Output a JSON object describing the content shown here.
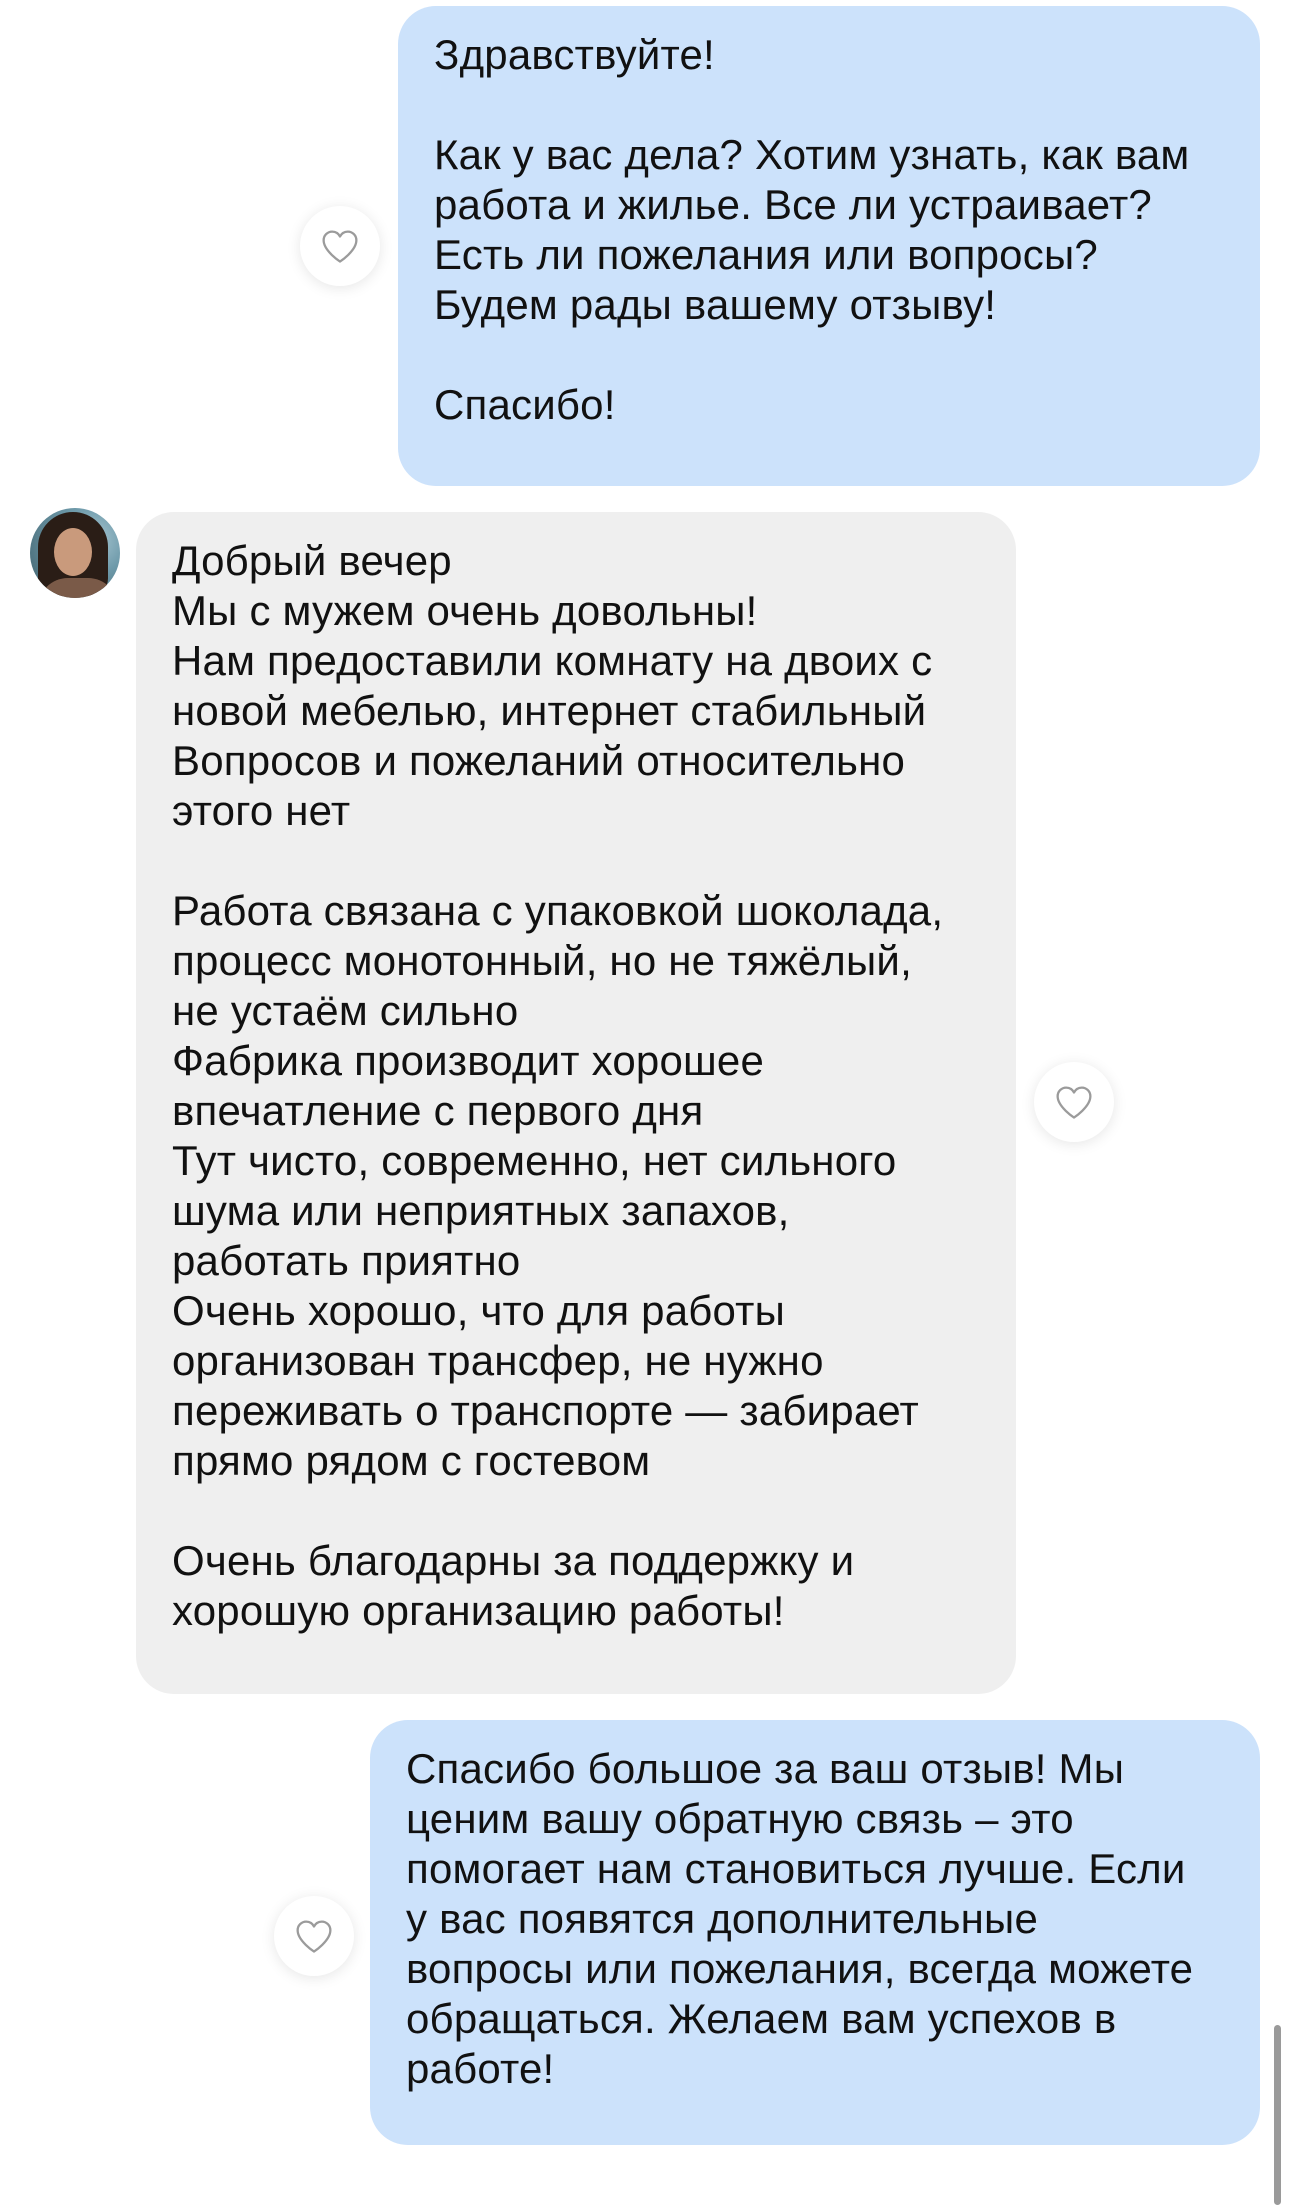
{
  "messages": [
    {
      "direction": "outgoing",
      "lines": [
        "Здравствуйте!",
        "",
        "Как у вас дела? Хотим узнать, как вам",
        "работа и жилье. Все ли устраивает?",
        "Есть ли пожелания или вопросы?",
        "Будем рады вашему отзыву!",
        "",
        "Спасибо!"
      ]
    },
    {
      "direction": "incoming",
      "lines": [
        "Добрый вечер",
        "Мы с мужем очень довольны!",
        "Нам предоставили комнату на двоих с",
        "новой мебелью, интернет стабильный",
        "Вопросов и пожеланий относительно",
        "этого нет",
        "",
        "Работа связана с упаковкой шоколада,",
        "процесс монотонный, но не тяжёлый,",
        "не устаём сильно",
        "Фабрика производит хорошее",
        "впечатление с первого дня",
        "Тут чисто, современно, нет сильного",
        "шума или неприятных запахов,",
        "работать приятно",
        "Очень хорошо, что для работы",
        "организован трансфер, не нужно",
        "переживать о транспорте — забирает",
        "прямо рядом с гостевом",
        "",
        "Очень благодарны за поддержку и",
        "хорошую организацию работы!"
      ]
    },
    {
      "direction": "outgoing",
      "lines": [
        "Спасибо большое за ваш отзыв! Мы",
        "ценим вашу обратную связь – это",
        "помогает нам становиться лучше. Если",
        "у вас появятся дополнительные",
        "вопросы или пожелания, всегда можете",
        "обращаться. Желаем вам успехов в",
        "работе!"
      ]
    }
  ],
  "icons": {
    "like": "heart-outline-icon",
    "avatar": "user-avatar"
  },
  "colors": {
    "outgoing_bubble": "#cce2fb",
    "incoming_bubble": "#efefef",
    "text": "#111111",
    "heart_stroke": "#9b9b9b"
  }
}
